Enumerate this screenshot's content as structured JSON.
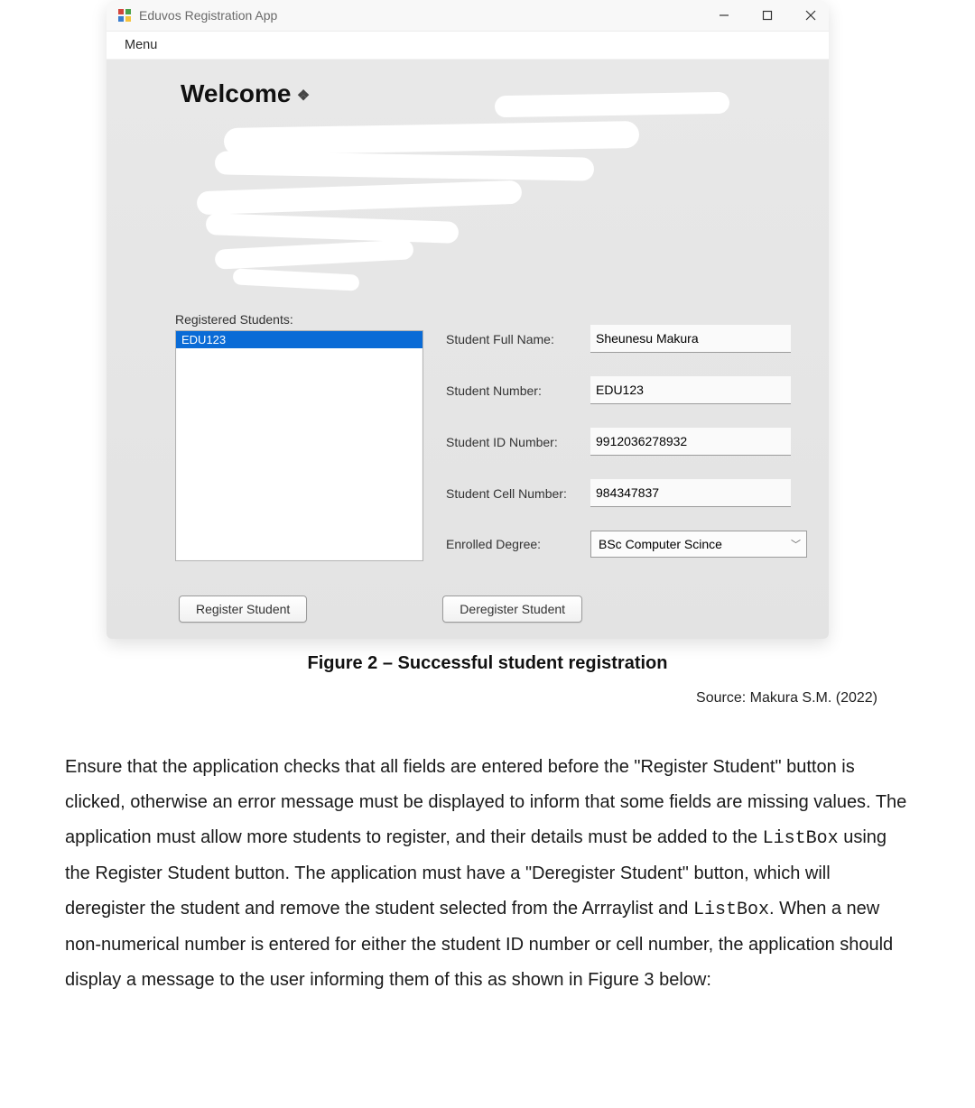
{
  "window": {
    "title": "Eduvos Registration App",
    "controls": {
      "min": "minimize",
      "max": "maximize",
      "close": "close"
    }
  },
  "menubar": {
    "items": [
      "Menu"
    ]
  },
  "welcome": "Welcome",
  "registered": {
    "label": "Registered Students:",
    "items": [
      "EDU123"
    ]
  },
  "fields": {
    "full_name": {
      "label": "Student Full Name:",
      "value": "Sheunesu Makura"
    },
    "number": {
      "label": "Student Number:",
      "value": "EDU123"
    },
    "id": {
      "label": "Student ID Number:",
      "value": "9912036278932"
    },
    "cell": {
      "label": "Student Cell Number:",
      "value": "984347837"
    },
    "degree": {
      "label": "Enrolled Degree:",
      "value": "BSc Computer Scince"
    }
  },
  "buttons": {
    "register": "Register Student",
    "deregister": "Deregister Student"
  },
  "figure": {
    "caption": "Figure 2 – Successful student registration",
    "source": "Source: Makura S.M. (2022)"
  },
  "paragraph": {
    "p1a": "Ensure that the application checks that all fields are entered before the \"Register Student\" button is clicked, otherwise an error message must be displayed to inform that some fields are missing values. The application must allow more students to register, and their details must be added to the ",
    "code1": "ListBox",
    "p1b": " using the Register Student button. The application must have a \"Deregister Student\" button, which will deregister the student and remove the student selected from the Arrraylist and ",
    "code2": "ListBox",
    "p1c": ". When a new non-numerical number is entered for either the student ID number or cell number, the application should display a message to the user informing them of this as shown in Figure 3 below:"
  }
}
